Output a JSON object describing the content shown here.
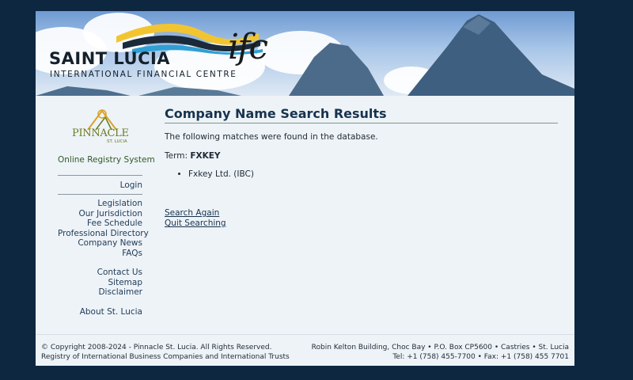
{
  "header": {
    "brand_line1": "SAINT LUCIA",
    "brand_line2": "INTERNATIONAL FINANCIAL CENTRE",
    "brand_ifc": "ifc"
  },
  "sidebar": {
    "logo_text": "PINNACLE",
    "logo_subtext": "ST. LUCIA",
    "system_name": "Online Registry System",
    "login": "Login",
    "group1": [
      "Legislation",
      "Our Jurisdiction",
      "Fee Schedule",
      "Professional Directory",
      "Company News",
      "FAQs"
    ],
    "group2": [
      "Contact Us",
      "Sitemap",
      "Disclaimer"
    ],
    "group3": [
      "About St. Lucia"
    ]
  },
  "main": {
    "title": "Company Name Search Results",
    "matches_text": "The following matches were found in the database.",
    "term_label": "Term:",
    "term_value": "FXKEY",
    "results": [
      "Fxkey Ltd. (IBC)"
    ],
    "search_again": "Search Again",
    "quit_searching": "Quit Searching"
  },
  "footer": {
    "left_line1": "© Copyright 2008-2024 - Pinnacle St. Lucia. All Rights Reserved.",
    "left_line2": "Registry of International Business Companies and International Trusts",
    "right_line1": "Robin Kelton Building, Choc Bay • P.O. Box CP5600 • Castries • St. Lucia",
    "right_line2": "Tel: +1 (758) 455-7700 • Fax: +1 (758) 455 7701"
  },
  "colors": {
    "page_background": "#0d2740",
    "panel_background": "#eef3f8",
    "title_color": "#17334d",
    "sidebar_system_color": "#2e5a25"
  }
}
